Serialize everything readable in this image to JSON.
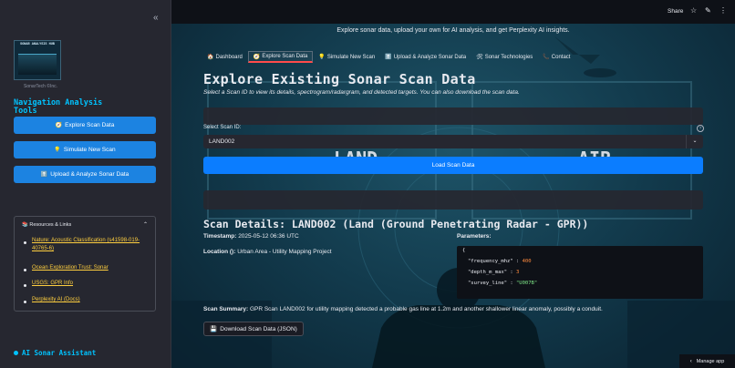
{
  "sidebar": {
    "logo_text": "SONAR ANALYSIS HUB",
    "logo_caption": "SonarTech ©Inc.",
    "nav_heading": "Navigation Analysis Tools",
    "buttons": [
      {
        "icon": "🧭",
        "label": "Explore Scan Data"
      },
      {
        "icon": "💡",
        "label": "Simulate New Scan"
      },
      {
        "icon": "⬆️",
        "label": "Upload & Analyze Sonar Data"
      }
    ],
    "resources": {
      "icon": "📚",
      "heading": "Resources & Links",
      "links": [
        "Nature: Acoustic Classification (s41598-019-40765-6)",
        "Ocean Exploration Trust: Sonar",
        "USGS: GPR Info",
        "Perplexity AI (Docs)"
      ]
    },
    "ai_heading": "AI Sonar Assistant"
  },
  "topbar": {
    "share_label": "Share"
  },
  "main": {
    "intro": "Explore sonar data, upload your own for AI analysis, and get Perplexity AI insights.",
    "tabs": [
      {
        "icon": "🏠",
        "label": "Dashboard"
      },
      {
        "icon": "🧭",
        "label": "Explore Scan Data"
      },
      {
        "icon": "💡",
        "label": "Simulate New Scan"
      },
      {
        "icon": "⬆️",
        "label": "Upload & Analyze Sonar Data"
      },
      {
        "icon": "🛠",
        "label": "Sonar Technologies"
      },
      {
        "icon": "📞",
        "label": "Contact"
      }
    ],
    "active_tab": 1,
    "title": "Explore Existing Sonar Scan Data",
    "subtitle": "Select a Scan ID to view its details, spectrogram/radargram, and detected targets. You can also download the scan data.",
    "select_label": "Select Scan ID:",
    "select_value": "LAND002",
    "load_button": "Load Scan Data",
    "details_heading": "Scan Details: LAND002 (Land (Ground Penetrating Radar - GPR))",
    "timestamp_label": "Timestamp:",
    "timestamp_value": "2025-05-12 06:36 UTC",
    "location_label": "Location ():",
    "location_value": "Urban Area - Utility Mapping Project",
    "parameters_label": "Parameters:",
    "params": {
      "open": "{",
      "frequency_key": "\"frequency_mhz\" :",
      "frequency_val": "400",
      "depth_key": "\"depth_m_max\" :",
      "depth_val": "3",
      "survey_key": "\"survey_line\" :",
      "survey_val": "\"U007B\""
    },
    "summary_label": "Scan Summary:",
    "summary_text": "GPR Scan LAND002 for utility mapping detected a probable gas line at 1.2m and another shallower linear anomaly, possibly a conduit.",
    "download_icon": "💾",
    "download_button": "Download Scan Data (JSON)",
    "bg_text_left": "LAND",
    "bg_text_right": "AIR"
  },
  "manage_app": "Manage app",
  "colors": {
    "accent": "#00c3ff",
    "primary_button": "#0b7dff",
    "sidebar_button": "#1c83e1",
    "link": "#ffcf3f",
    "active_tab_underline": "#ff4b4b"
  }
}
